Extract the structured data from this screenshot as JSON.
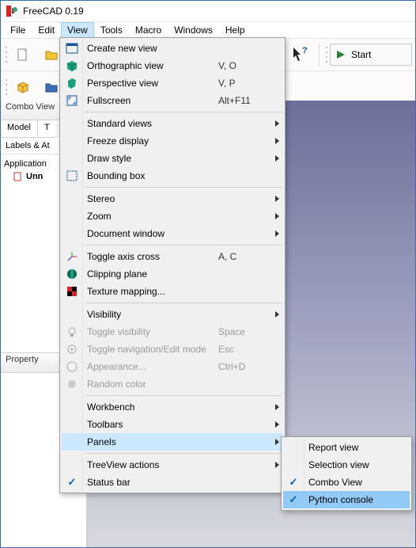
{
  "window": {
    "title": "FreeCAD 0.19"
  },
  "menubar": {
    "file": "File",
    "edit": "Edit",
    "view": "View",
    "tools": "Tools",
    "macro": "Macro",
    "windows": "Windows",
    "help": "Help"
  },
  "toolbar": {
    "start_label": "Start"
  },
  "combo": {
    "title": "Combo View",
    "tabs": {
      "model": "Model",
      "tasks": "T"
    },
    "labels_attrs": "Labels & At",
    "application": "Application",
    "item": "Unn",
    "property": "Property"
  },
  "view_menu": {
    "create_new_view": "Create new view",
    "orthographic": "Orthographic view",
    "orthographic_accel": "V, O",
    "perspective": "Perspective view",
    "perspective_accel": "V, P",
    "fullscreen": "Fullscreen",
    "fullscreen_accel": "Alt+F11",
    "standard_views": "Standard views",
    "freeze": "Freeze display",
    "draw_style": "Draw style",
    "bounding": "Bounding box",
    "stereo": "Stereo",
    "zoom": "Zoom",
    "doc_window": "Document window",
    "toggle_axis": "Toggle axis cross",
    "toggle_axis_accel": "A, C",
    "clipping": "Clipping plane",
    "texture": "Texture mapping...",
    "visibility": "Visibility",
    "toggle_vis": "Toggle visibility",
    "toggle_vis_accel": "Space",
    "toggle_nav": "Toggle navigation/Edit mode",
    "toggle_nav_accel": "Esc",
    "appearance": "Appearance...",
    "appearance_accel": "Ctrl+D",
    "random_color": "Random color",
    "workbench": "Workbench",
    "toolbars": "Toolbars",
    "panels": "Panels",
    "treeview": "TreeView actions",
    "statusbar": "Status bar"
  },
  "panels_menu": {
    "report": "Report view",
    "selection": "Selection view",
    "combo": "Combo View",
    "python": "Python console"
  }
}
